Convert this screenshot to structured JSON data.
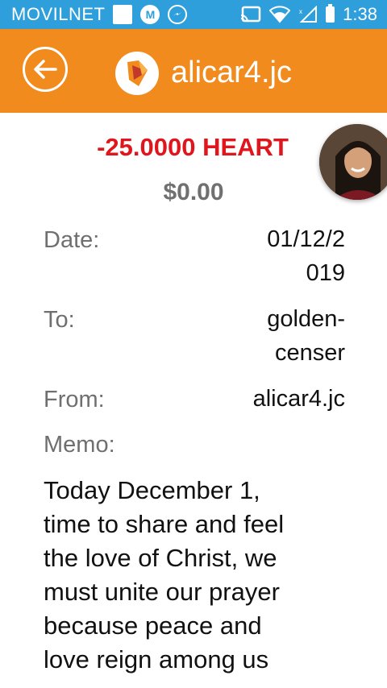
{
  "status_bar": {
    "carrier": "MOVILNET",
    "time": "1:38",
    "icons": [
      "app-square-icon",
      "messenger-m-icon",
      "messenger-icon",
      "cast-icon",
      "wifi-icon",
      "signal-icon",
      "battery-icon"
    ]
  },
  "app_bar": {
    "title": "alicar4.jc",
    "back_icon": "back-arrow-icon",
    "logo_icon": "steemit-logo-icon",
    "color": "#f28b1e"
  },
  "transfer": {
    "amount": "-25.0000 HEART",
    "amount_color": "#e0161d",
    "usd_value": "$0.00",
    "date_label": "Date:",
    "date_value_line1": "01/12/2",
    "date_value_line2": "019",
    "to_label": "To:",
    "to_value_line1": "golden-",
    "to_value_line2": "censer",
    "from_label": "From:",
    "from_value": "alicar4.jc",
    "memo_label": "Memo:",
    "memo_lines": [
      "Today December 1,",
      "time to share and feel",
      "the love of Christ, we",
      "must unite our prayer",
      "because peace and",
      "love reign among us"
    ]
  }
}
